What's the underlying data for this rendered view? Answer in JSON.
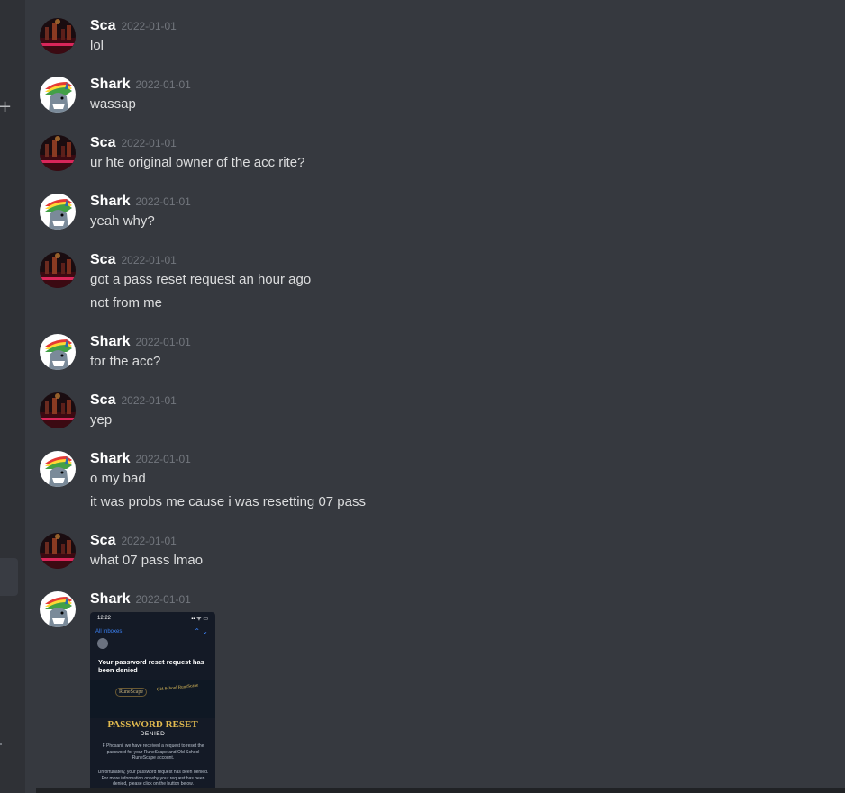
{
  "sidebar": {
    "add_icon": "plus-icon"
  },
  "messages": [
    {
      "user": "Sca",
      "avatar": "night-city-avatar",
      "time": "2022-01-01",
      "lines": [
        "lol"
      ]
    },
    {
      "user": "Shark",
      "avatar": "shark-avatar",
      "time": "2022-01-01",
      "lines": [
        "wassap"
      ]
    },
    {
      "user": "Sca",
      "avatar": "night-city-avatar",
      "time": "2022-01-01",
      "lines": [
        "ur hte original owner of the acc rite?"
      ]
    },
    {
      "user": "Shark",
      "avatar": "shark-avatar",
      "time": "2022-01-01",
      "lines": [
        "yeah why?"
      ]
    },
    {
      "user": "Sca",
      "avatar": "night-city-avatar",
      "time": "2022-01-01",
      "lines": [
        "got a pass reset request an hour ago",
        "not from me"
      ]
    },
    {
      "user": "Shark",
      "avatar": "shark-avatar",
      "time": "2022-01-01",
      "lines": [
        "for the acc?"
      ]
    },
    {
      "user": "Sca",
      "avatar": "night-city-avatar",
      "time": "2022-01-01",
      "lines": [
        "yep"
      ]
    },
    {
      "user": "Shark",
      "avatar": "shark-avatar",
      "time": "2022-01-01",
      "lines": [
        "o my bad",
        "it was probs me cause i was resetting 07 pass"
      ]
    },
    {
      "user": "Sca",
      "avatar": "night-city-avatar",
      "time": "2022-01-01",
      "lines": [
        "what 07 pass lmao"
      ]
    },
    {
      "user": "Shark",
      "avatar": "shark-avatar",
      "time": "2022-01-01",
      "lines": []
    }
  ],
  "attachment": {
    "status_time": "12:22",
    "status_icons": "▪▪ ᯤ ▭",
    "inbox_label": "All Inboxes",
    "nav_arrows": "⌃  ⌄",
    "mail_title": "Your password reset request has been denied",
    "logo_runescape": "RuneScape",
    "logo_osrs": "Old School RuneScape",
    "heading": "PASSWORD RESET",
    "subheading": "DENIED",
    "body_text": "F Phosani, we have received a request to reset the password for your RuneScape and Old School RuneScape account.",
    "body_text_2": "Unfortunately, your password request has been denied. For more information on why your request has been denied, please click on the button below."
  },
  "colors": {
    "background": "#36393f",
    "sidebar": "#2f3136",
    "username": "#ffffff",
    "timestamp": "#72767d",
    "message_text": "#dcddde"
  }
}
